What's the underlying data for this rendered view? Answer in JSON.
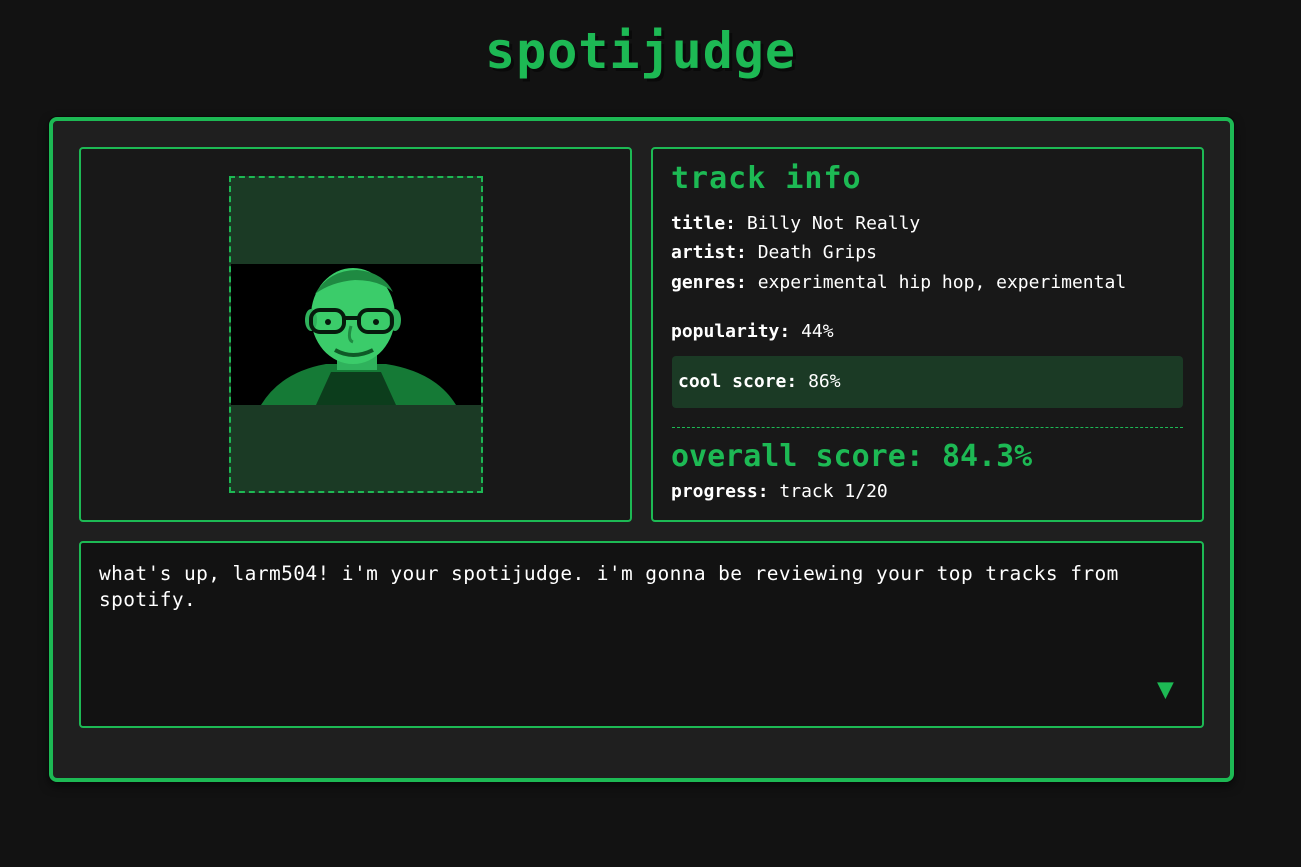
{
  "app": {
    "title": "spotijudge"
  },
  "album_art": {
    "icon": "album-cover-image"
  },
  "track_info": {
    "heading": "track info",
    "title_label": "title:",
    "title_value": "Billy Not Really",
    "artist_label": "artist:",
    "artist_value": "Death Grips",
    "genres_label": "genres:",
    "genres_value": "experimental hip hop, experimental",
    "popularity_label": "popularity:",
    "popularity_value": "44%",
    "cool_label": "cool score:",
    "cool_value": "86%",
    "overall_label": "overall score:",
    "overall_value": "84.3%",
    "progress_label": "progress:",
    "progress_value": "track 1/20"
  },
  "dialog": {
    "text": "what's up, larm504! i'm your spotijudge. i'm gonna be reviewing your top tracks from spotify.",
    "next_icon": "triangle-down-icon",
    "next_glyph": "▼"
  },
  "colors": {
    "accent": "#1db954",
    "panel_bg": "#181818",
    "highlight_bg": "#1b3a25",
    "page_bg": "#121212"
  }
}
